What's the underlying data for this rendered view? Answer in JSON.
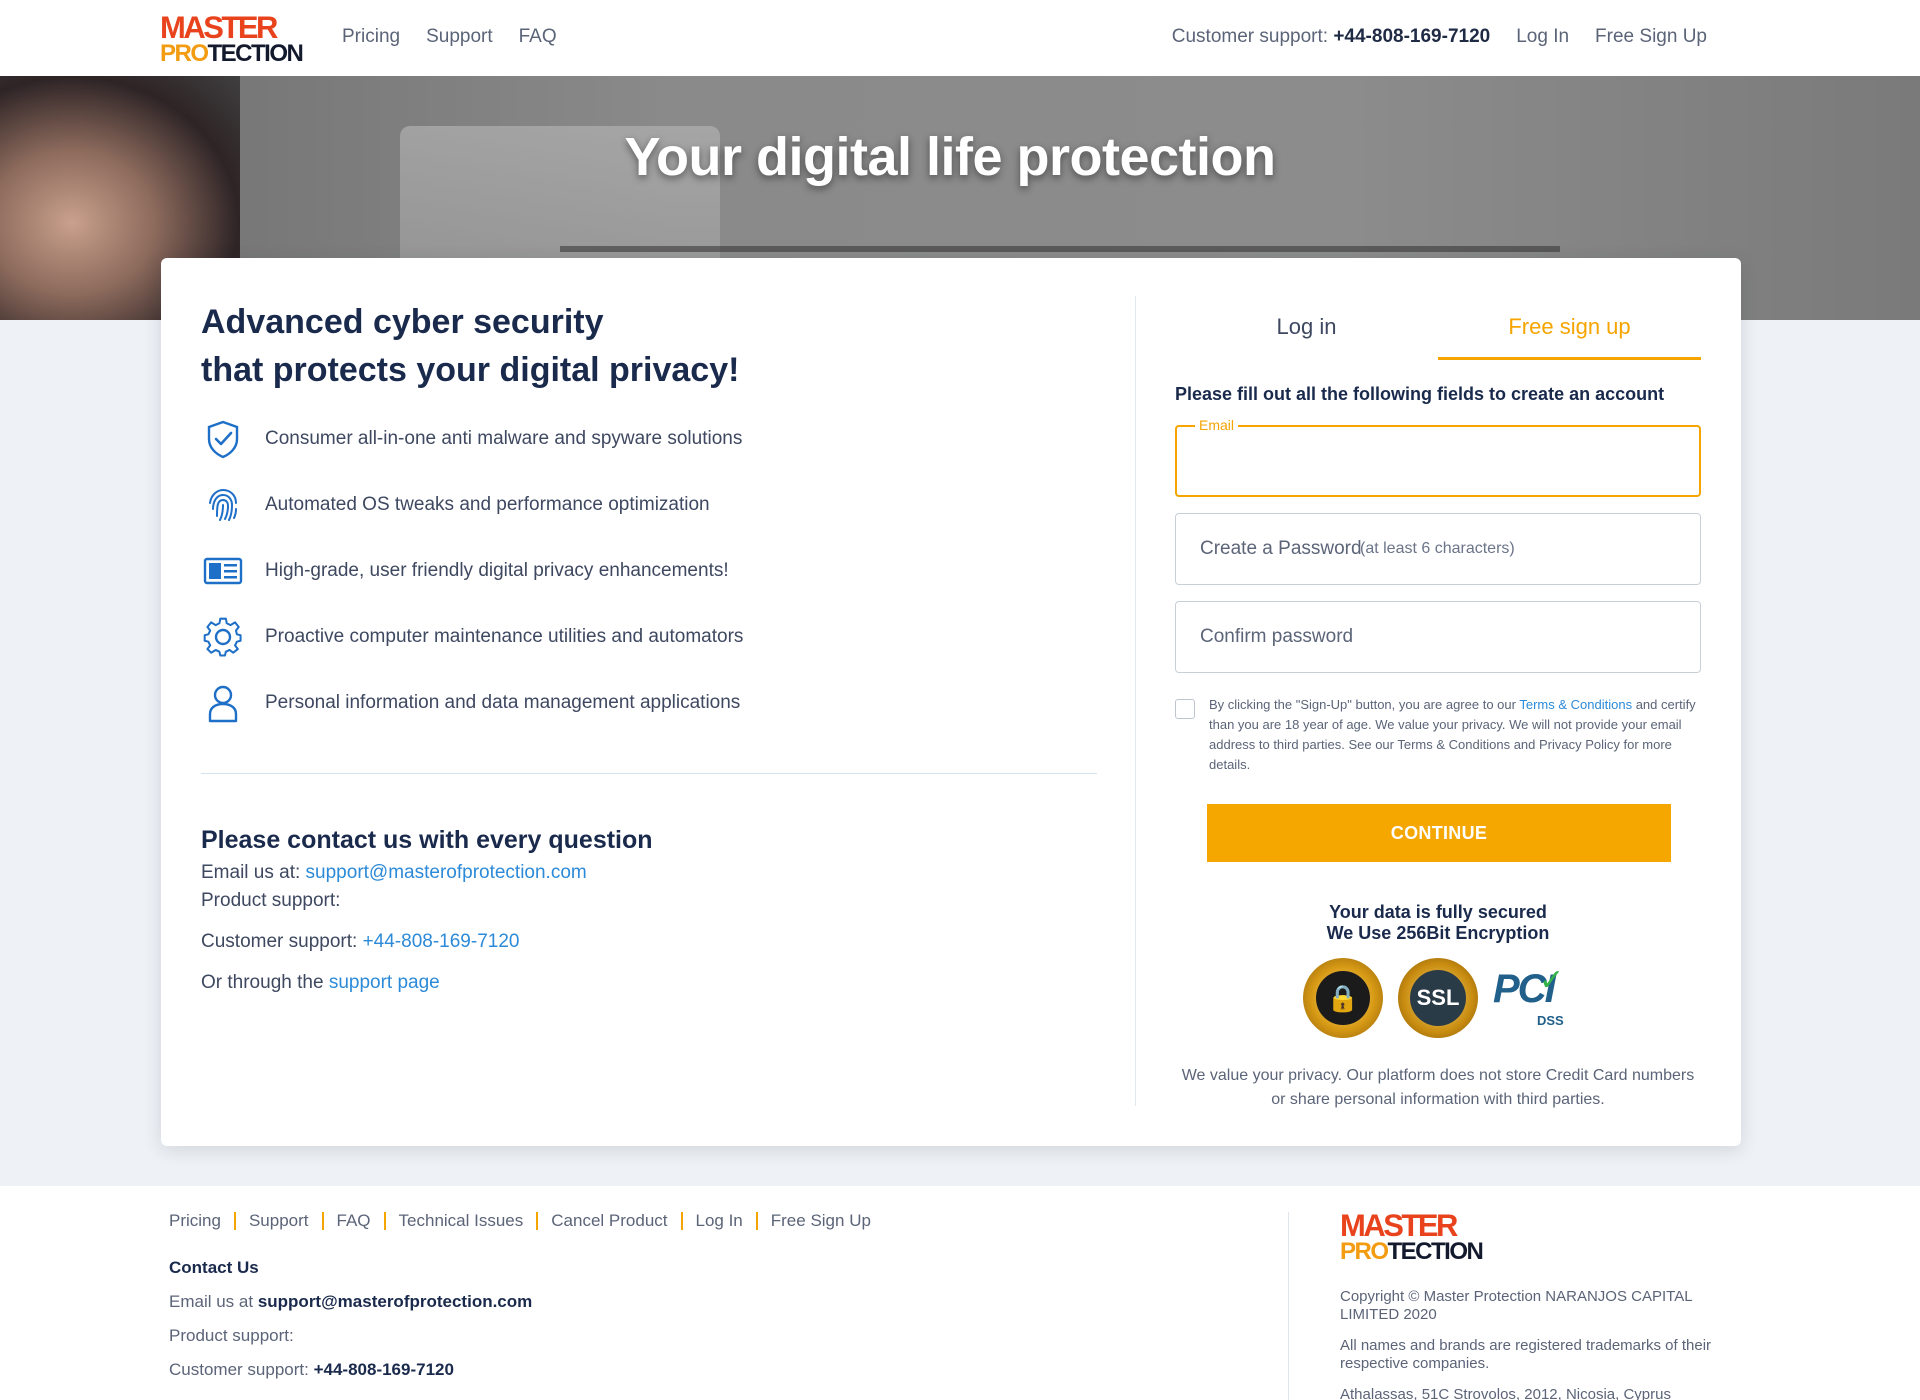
{
  "brand": {
    "line1": "MASTER",
    "line2_a": "PRO",
    "line2_b": "TECTION"
  },
  "nav": {
    "left": [
      "Pricing",
      "Support",
      "FAQ"
    ],
    "support_prefix": "Customer support:",
    "support_phone": "+44-808-169-7120",
    "login": "Log In",
    "signup": "Free Sign Up"
  },
  "hero": {
    "title": "Your digital life protection"
  },
  "left": {
    "headline_1": "Advanced cyber security",
    "headline_2": "that protects your digital privacy!",
    "features": [
      {
        "icon": "shield-check-icon",
        "text": "Consumer all-in-one anti malware and spyware solutions"
      },
      {
        "icon": "fingerprint-icon",
        "text": "Automated OS tweaks and performance optimization"
      },
      {
        "icon": "id-card-icon",
        "text": "High-grade, user friendly digital privacy enhancements!"
      },
      {
        "icon": "gear-icon",
        "text": "Proactive computer maintenance utilities and automators"
      },
      {
        "icon": "user-icon",
        "text": "Personal information and data management applications"
      }
    ],
    "contact": {
      "title": "Please contact us with every question",
      "email_prefix": "Email us at:",
      "email": "support@masterofprotection.com",
      "product_support": "Product support:",
      "customer_prefix": "Customer support:",
      "customer_phone": "+44-808-169-7120",
      "page_prefix": "Or through the",
      "page_link": "support page"
    }
  },
  "form": {
    "tab_login": "Log in",
    "tab_signup": "Free sign up",
    "active_tab": "signup",
    "title": "Please fill out all the following fields to create an account",
    "email_label": "Email",
    "email_value": "",
    "password_placeholder": "Create a Password",
    "password_hint": "(at least 6 characters)",
    "confirm_placeholder": "Confirm password",
    "consent_1": "By clicking the \"Sign-Up\" button, you are agree to our",
    "consent_link": "Terms & Conditions",
    "consent_2": "and certify than you are 18 year of age. We value your privacy. We will not provide your email address to third parties. See our Terms & Conditions and Privacy Policy for more details.",
    "consent_checked": false,
    "continue": "CONTINUE",
    "secure_1": "Your data is fully secured",
    "secure_2": "We Use 256Bit Encryption",
    "badges": {
      "ssl": "SSL",
      "pci": "PCI",
      "dss": "DSS"
    },
    "privacy": "We value your privacy. Our platform does not store Credit Card numbers or share personal information with third parties."
  },
  "footer": {
    "links": [
      "Pricing",
      "Support",
      "FAQ",
      "Technical Issues",
      "Cancel Product",
      "Log In",
      "Free Sign Up"
    ],
    "contact_title": "Contact Us",
    "email_prefix": "Email us at",
    "email": "support@masterofprotection.com",
    "product_support": "Product support:",
    "customer_prefix": "Customer support:",
    "customer_phone": "+44-808-169-7120",
    "copyright": "Copyright © Master Protection NARANJOS CAPITAL LIMITED 2020",
    "trademarks": "All names and brands are registered trademarks of their respective companies.",
    "address": "Athalassas, 51C Strovolos, 2012, Nicosia, Cyprus"
  },
  "colors": {
    "accent": "#f5a400",
    "link": "#2c8ad8",
    "navy": "#1a2a4c",
    "icon_blue": "#1e6fc8"
  }
}
